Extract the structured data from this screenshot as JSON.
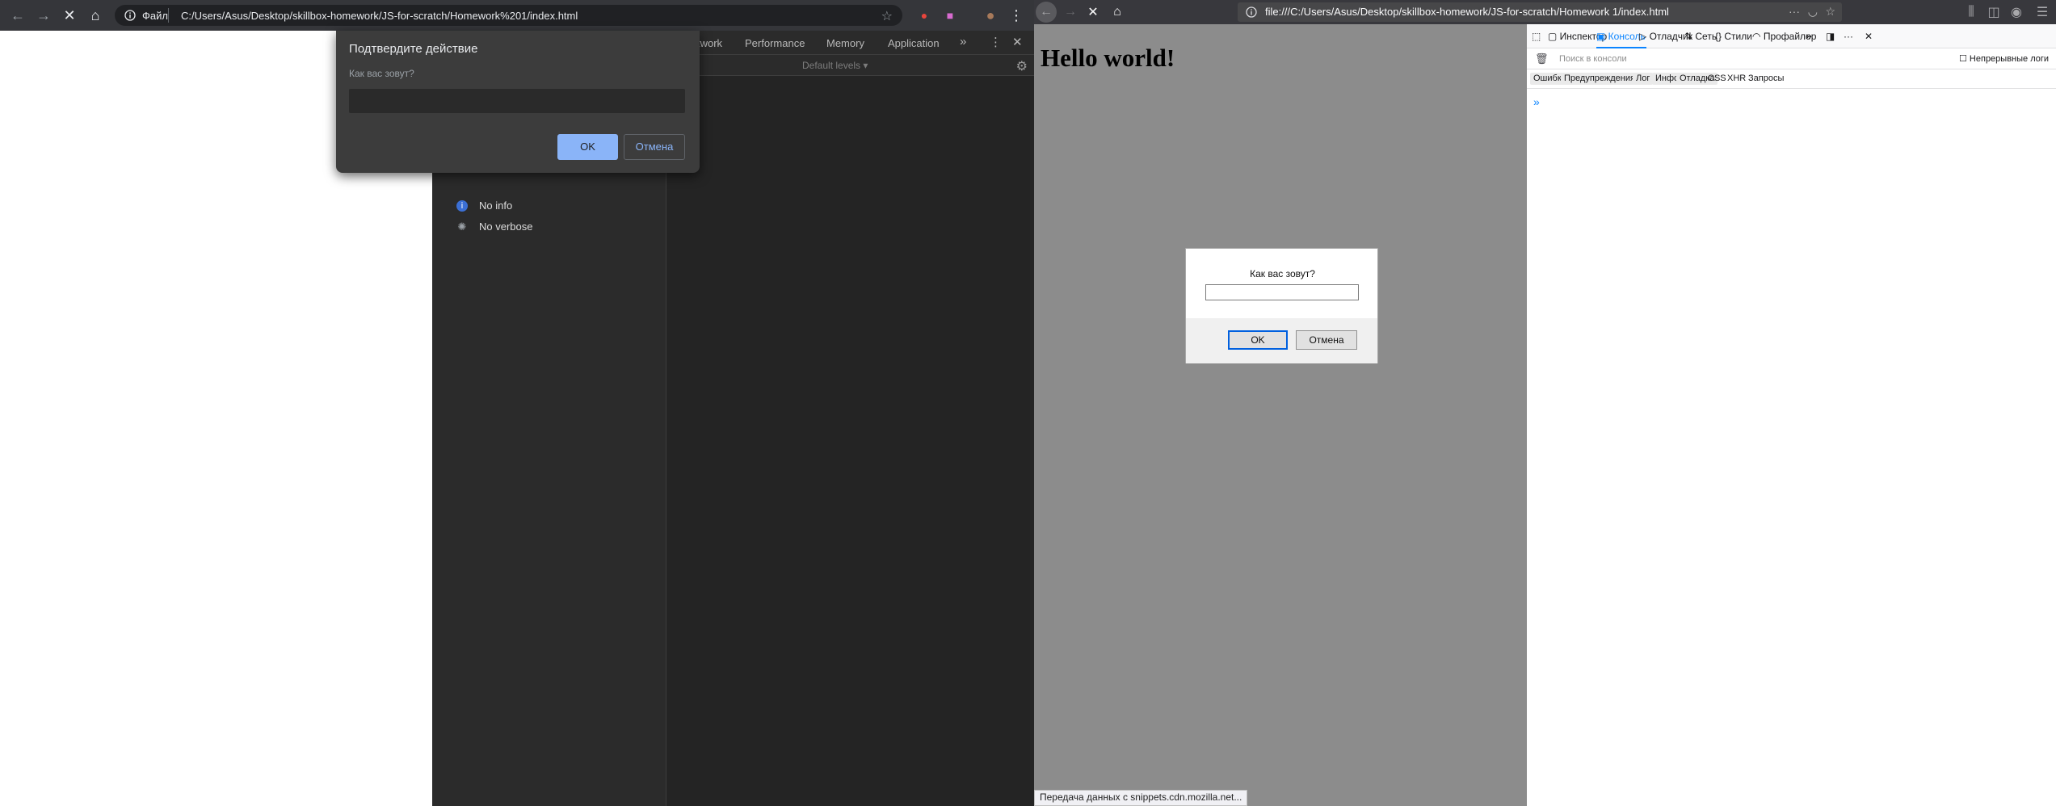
{
  "chrome": {
    "omnibox": {
      "scheme_label": "Файл",
      "url": "C:/Users/Asus/Desktop/skillbox-homework/JS-for-scratch/Homework%201/index.html"
    },
    "devtools": {
      "tabs": [
        "twork",
        "Performance",
        "Memory",
        "Application"
      ],
      "overflow": "»",
      "levels": "Default levels ▾",
      "sidebar": [
        {
          "label": "No info",
          "icon": "info-icon"
        },
        {
          "label": "No verbose",
          "icon": "bug-icon"
        }
      ]
    },
    "dialog": {
      "title": "Подтвердите действие",
      "message": "Как вас зовут?",
      "ok": "OK",
      "cancel": "Отмена"
    }
  },
  "firefox": {
    "url": "file:///C:/Users/Asus/Desktop/skillbox-homework/JS-for-scratch/Homework 1/index.html",
    "page": {
      "heading": "Hello world!",
      "status": "Передача данных с snippets.cdn.mozilla.net..."
    },
    "dialog": {
      "message": "Как вас зовут?",
      "ok": "OK",
      "cancel": "Отмена"
    },
    "devtools": {
      "tabs": [
        "Инспектор",
        "Консоль",
        "Отладчик",
        "Сеть",
        "Стили",
        "Профайлер"
      ],
      "active_tab": "Консоль",
      "filter_placeholder": "Поиск в консоли",
      "persist_logs": "Непрерывные логи",
      "levels": [
        "Ошибки",
        "Предупреждения",
        "Лог",
        "Инфо",
        "Отладка"
      ],
      "extra_filters": [
        "CSS",
        "XHR",
        "Запросы"
      ],
      "prompt": "»"
    }
  },
  "colors": {
    "chrome_ok": "#8ab4f8",
    "firefox_accent": "#0a84ff",
    "firefox_page_bg": "#8c8c8c"
  }
}
